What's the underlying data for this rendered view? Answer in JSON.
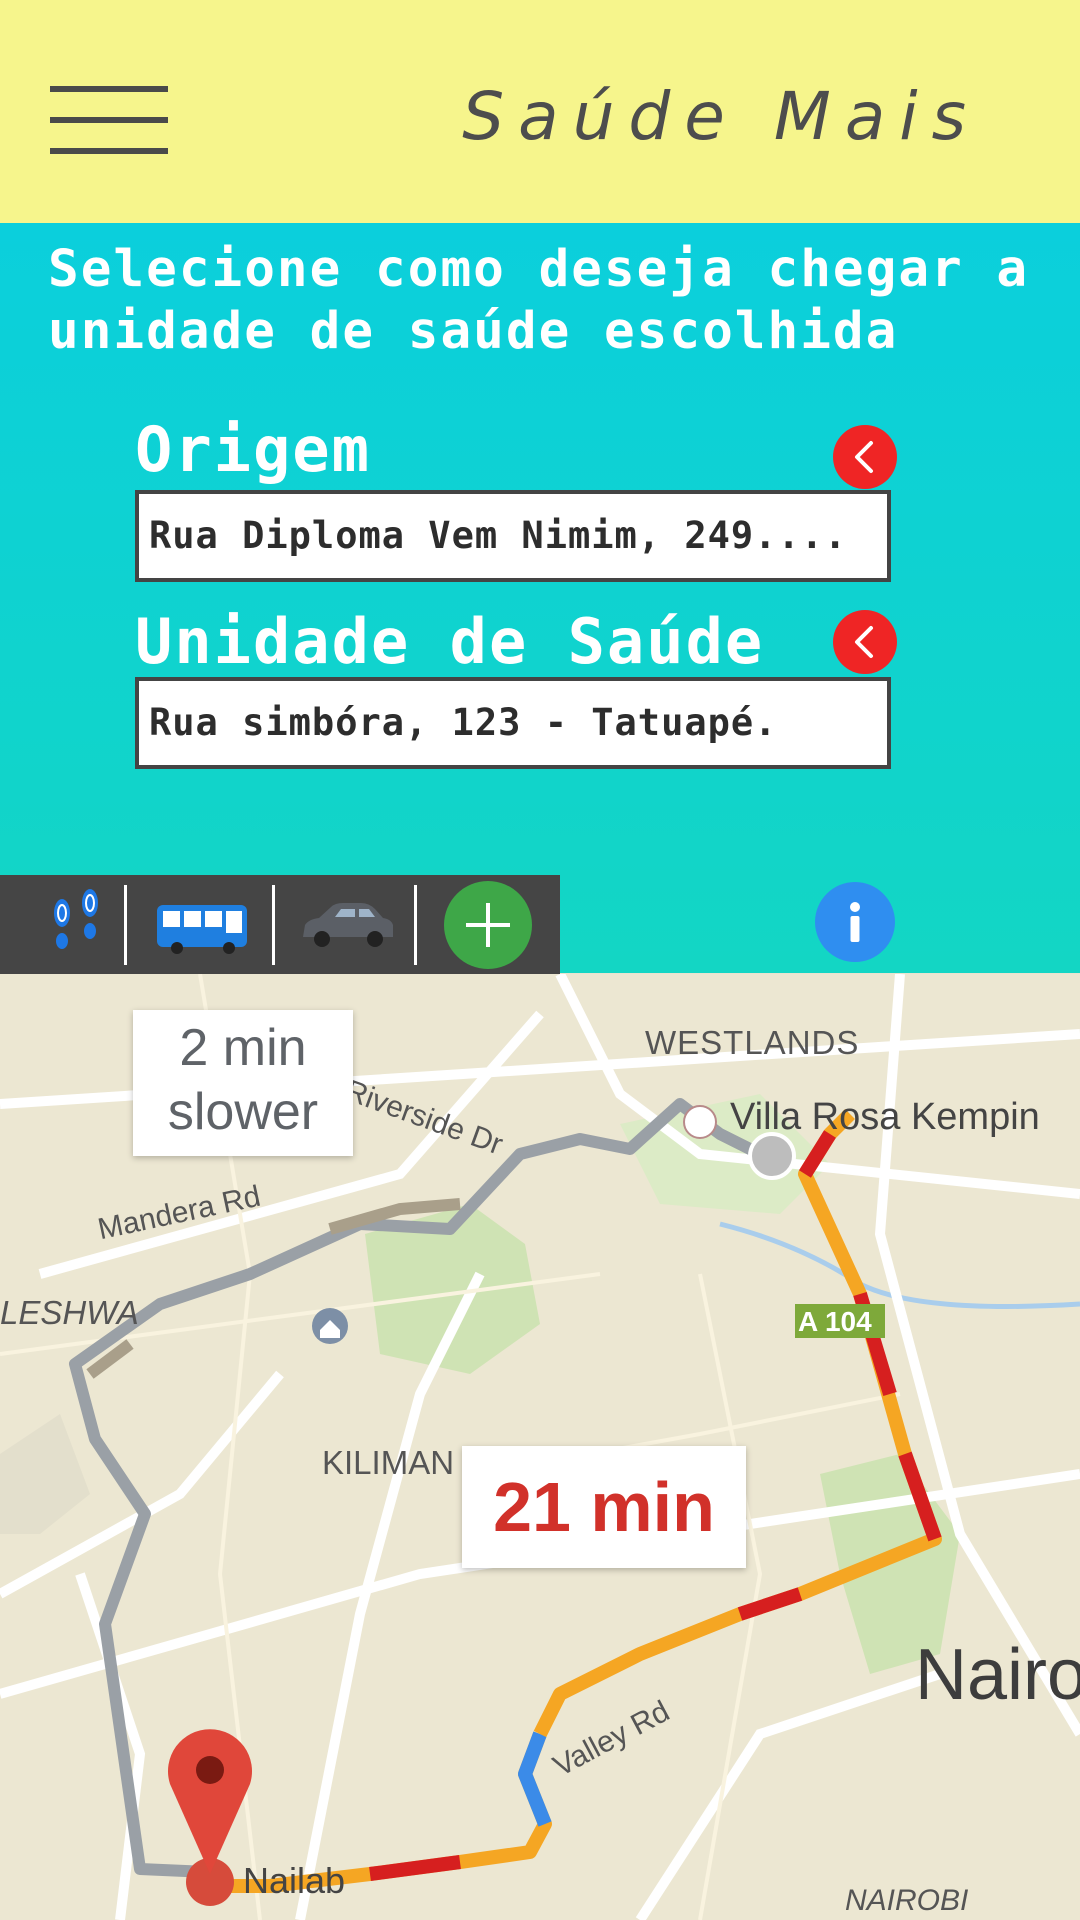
{
  "header": {
    "app_title": "Saúde Mais",
    "background_color": "#f6f58c",
    "menu_icon": "hamburger-menu-icon"
  },
  "form": {
    "instruction": "Selecione como deseja chegar a unidade de saúde escolhida",
    "origin": {
      "label": "Origem",
      "value": "Rua Diploma Vem Nimim, 249....",
      "clear_icon": "chevron-left-icon"
    },
    "destination": {
      "label": "Unidade de Saúde",
      "value": "Rua simbóra, 123 - Tatuapé.",
      "clear_icon": "chevron-left-icon"
    },
    "accent_color": "#ef2525"
  },
  "transport": {
    "modes": [
      {
        "icon": "walking-footprints-icon"
      },
      {
        "icon": "bus-icon"
      },
      {
        "icon": "car-icon"
      },
      {
        "icon": "add-plus-icon"
      }
    ],
    "info_icon": "info-icon"
  },
  "map": {
    "area_labels": [
      "WESTLANDS",
      "LESHWA",
      "KILIMAN",
      "NAIROBI",
      "Nairo"
    ],
    "road_labels": [
      "Riverside Dr",
      "Mandera Rd",
      "Valley Rd",
      "A 104"
    ],
    "poi_labels": [
      "Villa Rosa Kempin",
      "Nailab"
    ],
    "alt_route_callout": {
      "line1": "2 min",
      "line2": "slower"
    },
    "main_route_callout": "21 min",
    "route_colors": {
      "slow": "#d61f1f",
      "medium": "#f5a623",
      "fast": "#3b8be8",
      "alternate": "#9aa0a6"
    }
  }
}
